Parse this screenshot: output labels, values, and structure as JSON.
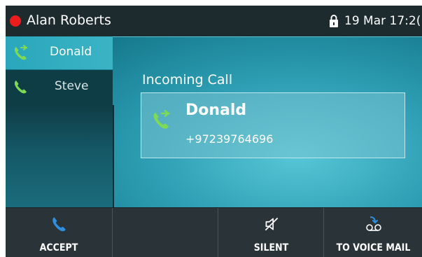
{
  "status_bar": {
    "user_name": "Alan Roberts",
    "status_color": "#ee1d1d",
    "lock_icon": "lock-icon",
    "datetime": "19 Mar 17:2("
  },
  "lines": [
    {
      "label": "Donald",
      "icon": "incoming-call-icon",
      "active": true
    },
    {
      "label": "Steve",
      "icon": "phone-icon",
      "active": false
    }
  ],
  "call": {
    "heading": "Incoming Call",
    "caller_name": "Donald",
    "caller_number": "+97239764696",
    "icon": "incoming-call-icon"
  },
  "softkeys": [
    {
      "label": "ACCEPT",
      "icon": "phone-icon",
      "icon_color": "#2f8fe0"
    },
    {
      "label": "",
      "icon": ""
    },
    {
      "label": "SILENT",
      "icon": "speaker-mute-icon"
    },
    {
      "label": "TO VOICE MAIL",
      "icon": "voicemail-icon"
    }
  ],
  "colors": {
    "accent_green": "#7ed957",
    "accent_blue": "#2f8fe0",
    "status_red": "#ee1d1d"
  }
}
